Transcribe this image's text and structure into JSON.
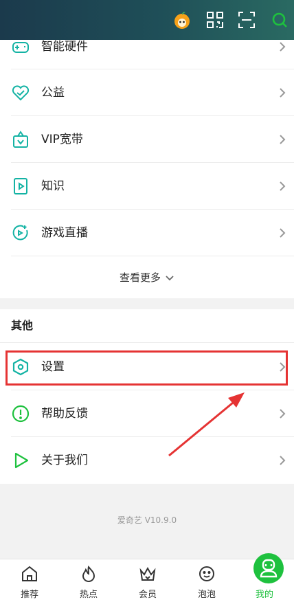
{
  "menu_items": [
    {
      "label": "智能硬件",
      "icon": "gamepad-icon"
    },
    {
      "label": "公益",
      "icon": "heart-check-icon"
    },
    {
      "label": "VIP宽带",
      "icon": "broadband-icon"
    },
    {
      "label": "知识",
      "icon": "book-icon"
    },
    {
      "label": "游戏直播",
      "icon": "game-live-icon"
    }
  ],
  "see_more": "查看更多",
  "section_other": {
    "title": "其他",
    "items": [
      {
        "label": "设置",
        "icon": "settings-hex-icon"
      },
      {
        "label": "帮助反馈",
        "icon": "exclamation-circle-icon"
      },
      {
        "label": "关于我们",
        "icon": "play-triangle-icon"
      }
    ]
  },
  "version_text": "爱奇艺 V10.9.0",
  "tabs": [
    {
      "label": "推荐",
      "icon": "home-icon"
    },
    {
      "label": "热点",
      "icon": "flame-icon"
    },
    {
      "label": "会员",
      "icon": "crown-icon"
    },
    {
      "label": "泡泡",
      "icon": "face-bubble-icon"
    },
    {
      "label": "我的",
      "icon": "profile-icon",
      "active": true
    }
  ],
  "colors": {
    "accent": "#1ec13e",
    "icon_teal": "#14b3a4",
    "highlight": "#e53333"
  }
}
